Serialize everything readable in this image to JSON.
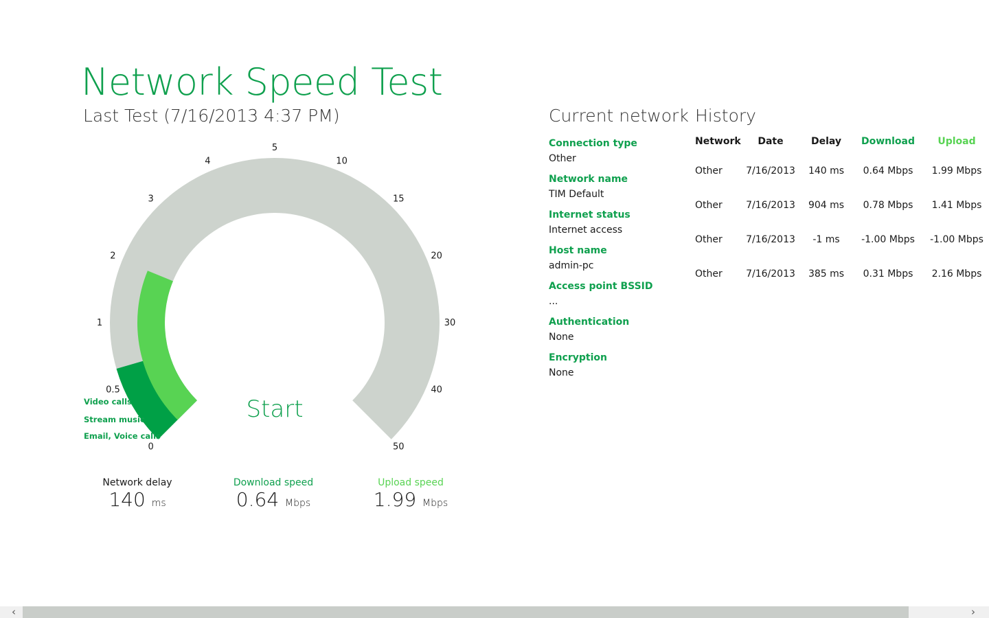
{
  "header": {
    "title": "Network Speed Test",
    "last_test": "Last Test (7/16/2013 4:37 PM)"
  },
  "gauge": {
    "scale_min": 0,
    "scale_max": 50,
    "ticks": [
      "0",
      "0.5",
      "1",
      "2",
      "3",
      "4",
      "5",
      "10",
      "15",
      "20",
      "30",
      "40",
      "50"
    ],
    "download_mbps": 0.64,
    "upload_mbps": 1.99,
    "zone_labels": [
      "Video calls",
      "Stream music",
      "Email, Voice calls"
    ],
    "start_label": "Start",
    "colors": {
      "track": "#cdd3cd",
      "download": "#00a046",
      "upload": "#58d353",
      "accent": "#0fa04e"
    }
  },
  "stats": {
    "delay": {
      "label": "Network delay",
      "value": "140",
      "unit": "ms"
    },
    "download": {
      "label": "Download speed",
      "value": "0.64",
      "unit": "Mbps"
    },
    "upload": {
      "label": "Upload speed",
      "value": "1.99",
      "unit": "Mbps"
    }
  },
  "current_network": {
    "heading": "Current network",
    "items": [
      {
        "key": "Connection type",
        "value": "Other"
      },
      {
        "key": "Network name",
        "value": "TIM Default"
      },
      {
        "key": "Internet status",
        "value": "Internet access"
      },
      {
        "key": "Host name",
        "value": "admin-pc"
      },
      {
        "key": "Access point BSSID",
        "value": "..."
      },
      {
        "key": "Authentication",
        "value": "None"
      },
      {
        "key": "Encryption",
        "value": "None"
      }
    ]
  },
  "history": {
    "heading": "History",
    "columns": [
      "Network",
      "Date",
      "Delay",
      "Download",
      "Upload"
    ],
    "rows": [
      [
        "Other",
        "7/16/2013",
        "140 ms",
        "0.64 Mbps",
        "1.99 Mbps"
      ],
      [
        "Other",
        "7/16/2013",
        "904 ms",
        "0.78 Mbps",
        "1.41 Mbps"
      ],
      [
        "Other",
        "7/16/2013",
        "-1 ms",
        "-1.00 Mbps",
        "-1.00 Mbps"
      ],
      [
        "Other",
        "7/16/2013",
        "385 ms",
        "0.31 Mbps",
        "2.16 Mbps"
      ]
    ]
  },
  "scrollbar": {
    "left_icon": "chevron-left-icon",
    "right_icon": "chevron-right-icon",
    "left_glyph": "‹",
    "right_glyph": "›"
  }
}
